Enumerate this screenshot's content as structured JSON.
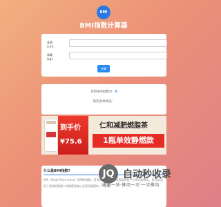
{
  "header": {
    "logo_text": "BMI",
    "title": "BMI指数计算器"
  },
  "form": {
    "height_label": "身高 (cm):",
    "height_value": "",
    "weight_label": "体重 (kg):",
    "weight_value": "",
    "submit_label": "计算"
  },
  "result": {
    "bmi_label": "您的BMI指数为:",
    "bmi_value": "0",
    "status_label": "您的身体状态:",
    "status_value": ""
  },
  "ad": {
    "price_title": "到手价",
    "price_value": "¥75.6",
    "headline": "仁和减肥燃脂茶",
    "slogan": "1瓶单效静燃款"
  },
  "info": {
    "title": "什么是BMI指数?",
    "text": "BMI（Body Mass Index）即BMI指数，是用体重公斤数除以身高米数平方得出的数字，是目前国际上常用的衡量人体胖瘦程度以及是否健康的一个标准。"
  },
  "watermark": {
    "logo_text": "JQ",
    "title": "自动秒收录",
    "slogan": "收录一站·推动一次·一次推动"
  },
  "colors": {
    "accent": "#2a7ae6",
    "ad_red": "#e52d26",
    "background_start": "#f2b07f",
    "background_end": "#e07f88"
  }
}
